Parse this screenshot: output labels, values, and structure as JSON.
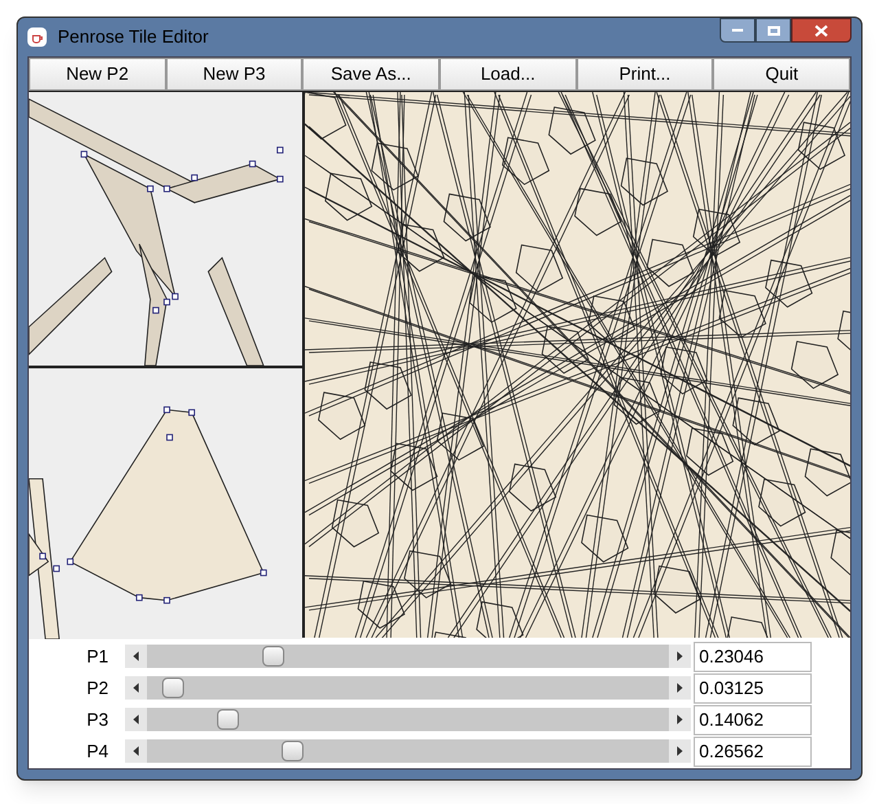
{
  "window": {
    "title": "Penrose Tile Editor"
  },
  "toolbar": [
    "New P2",
    "New P3",
    "Save As...",
    "Load...",
    "Print...",
    "Quit"
  ],
  "parameters": [
    {
      "label": "P1",
      "level": 0.23,
      "value": "0.23046"
    },
    {
      "label": "P2",
      "level": 0.03,
      "value": "0.03125"
    },
    {
      "label": "P3",
      "level": 0.14,
      "value": "0.14062"
    },
    {
      "label": "P4",
      "level": 0.27,
      "value": "0.26562"
    }
  ]
}
